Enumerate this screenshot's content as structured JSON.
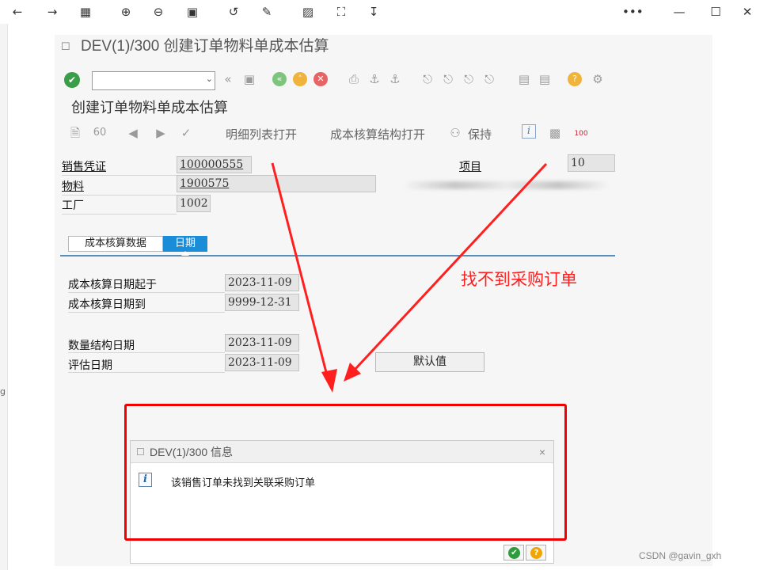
{
  "browser_toolbar": {
    "icons": [
      "back-arrow-icon",
      "forward-arrow-icon",
      "grid-view-icon",
      "zoom-in-icon",
      "zoom-out-icon",
      "actual-size-icon",
      "rotate-icon",
      "edit-icon",
      "translate-icon",
      "crop-icon",
      "download-icon"
    ],
    "more_label": "•••",
    "minimize_label": "—",
    "maximize_label": "☐",
    "close_label": "✕"
  },
  "left_edge": {
    "fragment": "g"
  },
  "window": {
    "title": "DEV(1)/300 创建订单物料单成本估算"
  },
  "screen": {
    "title": "创建订单物料单成本估算"
  },
  "app_toolbar": {
    "open_detail_list": "明细列表打开",
    "open_cost_structure": "成本核算结构打开",
    "hold": "保持"
  },
  "header_fields": {
    "sales_doc_label": "销售凭证",
    "sales_doc_value": "100000555",
    "material_label": "物料",
    "material_value": "1900575",
    "plant_label": "工厂",
    "plant_value": "1002",
    "item_label": "项目",
    "item_value": "10"
  },
  "tabs": [
    {
      "label": "成本核算数据",
      "active": false
    },
    {
      "label": "日期",
      "active": true
    }
  ],
  "dates": {
    "costing_date_from_label": "成本核算日期起于",
    "costing_date_from_value": "2023-11-09",
    "costing_date_to_label": "成本核算日期到",
    "costing_date_to_value": "9999-12-31",
    "qty_structure_date_label": "数量结构日期",
    "qty_structure_date_value": "2023-11-09",
    "valuation_date_label": "评估日期",
    "valuation_date_value": "2023-11-09",
    "default_button": "默认值"
  },
  "dialog": {
    "title": "DEV(1)/300 信息",
    "close_label": "×",
    "message": "该销售订单未找到关联采购订单",
    "ok_symbol": "✔",
    "help_symbol": "?"
  },
  "annotation": {
    "text": "找不到采购订单",
    "color": "#ff2020"
  },
  "watermark": "CSDN @gavin_gxh",
  "colors": {
    "active_tab": "#1a8cd8",
    "annotation_red": "#ff2020",
    "ok_green": "#2e9b3c",
    "help_orange": "#f0a500"
  }
}
